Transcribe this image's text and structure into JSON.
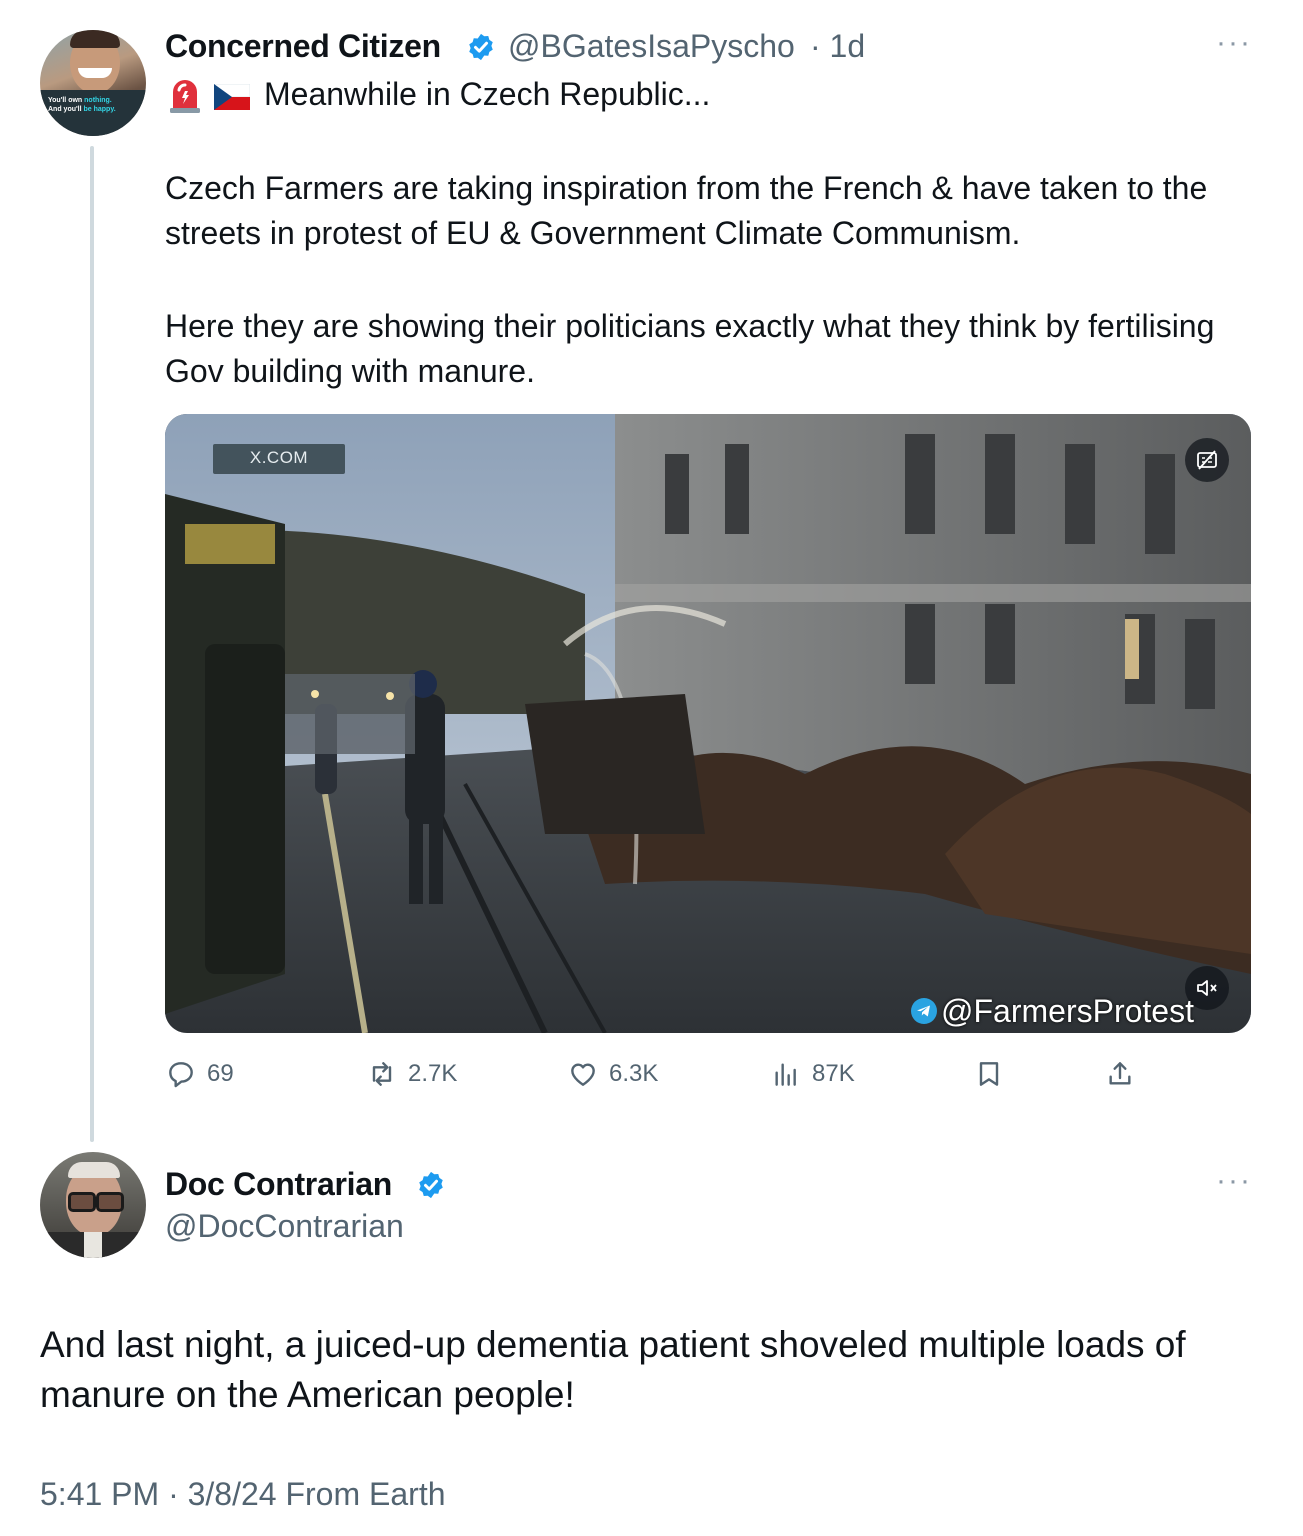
{
  "tweet": {
    "author_name": "Concerned Citizen",
    "handle": "@BGatesIsaPyscho",
    "time": "· 1d",
    "avatar_text_1": "You'll own ",
    "avatar_text_nothing": "nothing.",
    "avatar_text_2": "And you'll ",
    "avatar_text_happy": "be happy.",
    "line1": "Meanwhile in Czech Republic...",
    "para1": "Czech Farmers are taking inspiration from the French & have taken to the streets in protest of EU & Government Climate Communism.",
    "para2": "Here they are showing their politicians exactly what they think by fertilising Gov building with manure.",
    "media": {
      "watermark": "X.COM",
      "credit": "@FarmersProtest"
    },
    "stats": {
      "replies": "69",
      "reposts": "2.7K",
      "likes": "6.3K",
      "views": "87K"
    }
  },
  "reply": {
    "author_name": "Doc Contrarian",
    "handle": "@DocContrarian",
    "text": "And last night, a juiced-up dementia patient shoveled multiple loads of manure on the American people!",
    "footer": "5:41 PM · 3/8/24 From Earth"
  },
  "colors": {
    "verified": "#1d9bf0",
    "secondary_text": "#536471",
    "thread_line": "#cfd9de"
  },
  "icons": [
    "siren-icon",
    "czech-flag-icon",
    "verified-badge-icon",
    "more-icon",
    "captions-off-icon",
    "mute-icon",
    "telegram-icon",
    "reply-icon",
    "repost-icon",
    "like-icon",
    "views-icon",
    "bookmark-icon",
    "share-icon"
  ]
}
